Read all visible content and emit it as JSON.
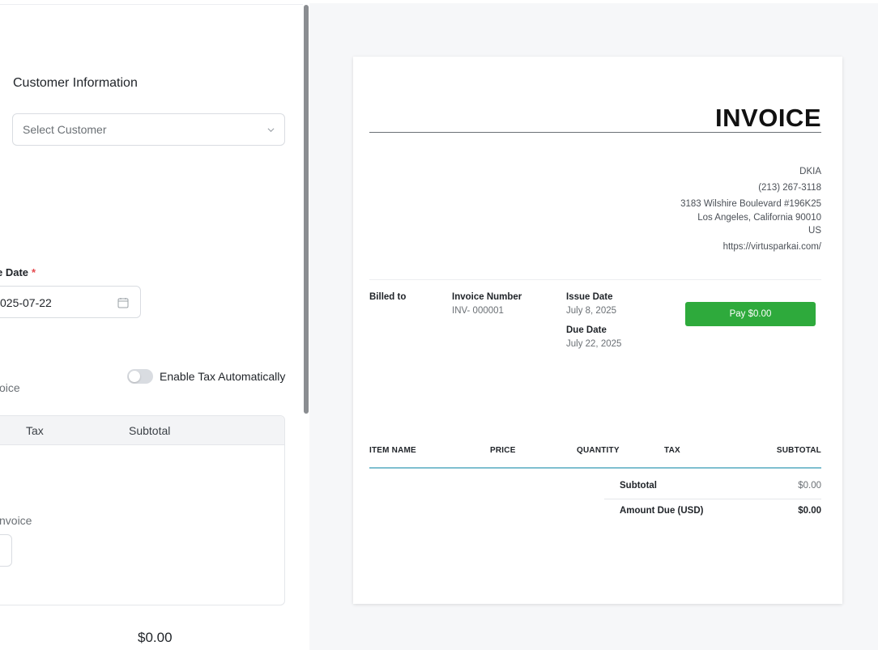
{
  "editor": {
    "customer_section_title": "Customer Information",
    "customer_select_placeholder": "Select Customer",
    "due_date_label": "e Date",
    "due_date_required": "*",
    "due_date_value": "025-07-22",
    "enable_tax_label": "Enable Tax Automatically",
    "enable_tax_on": false,
    "partial_label_1": "oice",
    "table_headers": {
      "tax": "Tax",
      "subtotal": "Subtotal"
    },
    "partial_label_2": "nvoice",
    "total_amount": "$0.00"
  },
  "invoice": {
    "title": "INVOICE",
    "company": {
      "name": "DKIA",
      "phone": "(213) 267-3118",
      "address_line1": "3183 Wilshire Boulevard #196K25",
      "address_line2": "Los Angeles, California 90010",
      "country": "US",
      "website": "https://virtusparkai.com/"
    },
    "billed_to_label": "Billed to",
    "invoice_number_label": "Invoice Number",
    "invoice_number": "INV- 000001",
    "issue_date_label": "Issue Date",
    "issue_date": "July 8, 2025",
    "due_date_label": "Due Date",
    "due_date": "July 22, 2025",
    "pay_button_label": "Pay $0.00",
    "columns": {
      "item_name": "ITEM NAME",
      "price": "PRICE",
      "quantity": "QUANTITY",
      "tax": "TAX",
      "subtotal": "SUBTOTAL"
    },
    "summary": {
      "subtotal_label": "Subtotal",
      "subtotal_value": "$0.00",
      "amount_due_label": "Amount Due (USD)",
      "amount_due_value": "$0.00"
    }
  },
  "colors": {
    "pay_button": "#2eaa3c",
    "items_rule": "#7fbfd0",
    "required": "#e5484d"
  }
}
